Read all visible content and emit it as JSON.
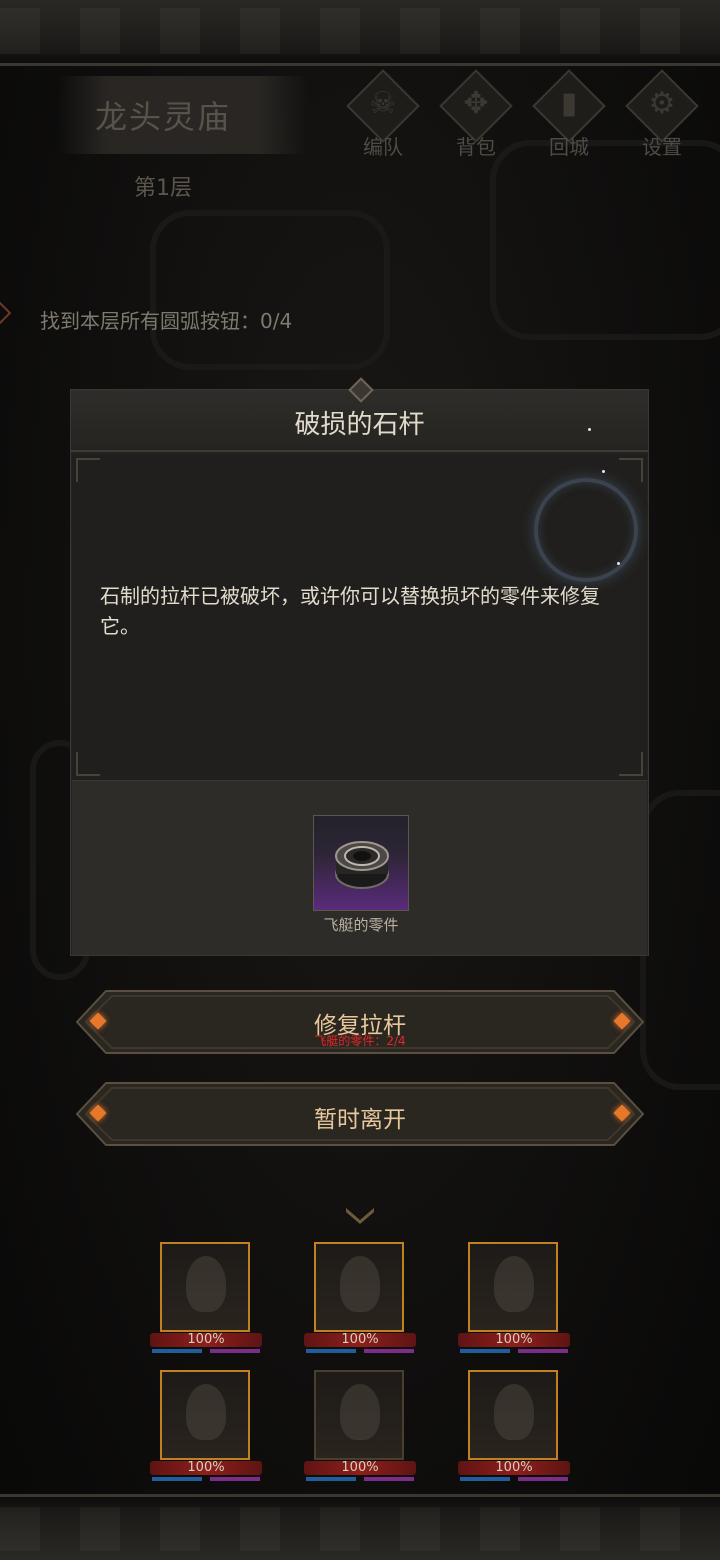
{
  "location": {
    "name": "龙头灵庙",
    "floor": "第1层"
  },
  "top_menu": [
    {
      "label": "编队",
      "icon": "horned-skull-icon"
    },
    {
      "label": "背包",
      "icon": "bag-icon"
    },
    {
      "label": "回城",
      "icon": "door-icon"
    },
    {
      "label": "设置",
      "icon": "gear-icon"
    }
  ],
  "quest": {
    "text": "找到本层所有圆弧按钮：0/4"
  },
  "dialog": {
    "title": "破损的石杆",
    "description": "石制的拉杆已被破坏，或许你可以替换损坏的零件来修复它。",
    "item": {
      "name": "飞艇的零件",
      "icon": "airship-part-gear-icon"
    }
  },
  "actions": {
    "repair": {
      "label": "修复拉杆",
      "requirement": "飞艇的零件：2/4"
    },
    "leave": {
      "label": "暂时离开"
    }
  },
  "party": [
    {
      "hp": "100%",
      "portrait": "blonde-heroine-portrait"
    },
    {
      "hp": "100%",
      "portrait": "armored-dragonkin-portrait"
    },
    {
      "hp": "100%",
      "portrait": "hat-rogue-portrait"
    },
    {
      "hp": "100%",
      "portrait": "crowned-priestess-portrait"
    },
    {
      "hp": "100%",
      "portrait": "werewolf-portrait"
    },
    {
      "hp": "100%",
      "portrait": "silver-hair-maiden-portrait"
    }
  ],
  "colors": {
    "accent_gold": "#e7c89c",
    "requirement_red": "#e5262a",
    "gem_orange": "#e7782a",
    "hp_red": "#8e1f1b",
    "mp_blue": "#1f5e9c"
  }
}
